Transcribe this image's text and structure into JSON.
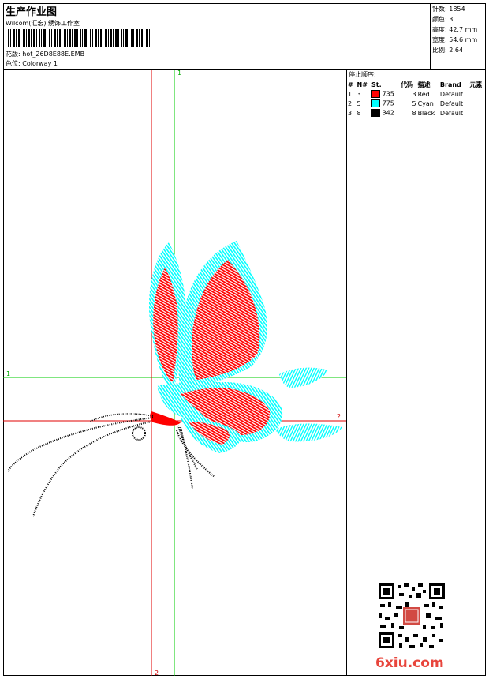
{
  "header": {
    "title": "生产作业图",
    "company": "Wilcom(汇宏) 绣饰工作室",
    "design_label": "花版:",
    "design_value": "hot_26D8E88E.EMB",
    "colorway_label": "色位:",
    "colorway_value": "Colorway 1"
  },
  "stats": [
    {
      "label": "针数:",
      "value": "1854"
    },
    {
      "label": "颜色:",
      "value": "3"
    },
    {
      "label": "高度:",
      "value": "42.7 mm"
    },
    {
      "label": "宽度:",
      "value": "54.6 mm"
    },
    {
      "label": "比例:",
      "value": "2.64"
    }
  ],
  "stop_sequence": {
    "heading": "停止顺序:",
    "columns": [
      "#",
      "N#",
      "St.",
      "代码",
      "描述",
      "Brand",
      "元素"
    ],
    "rows": [
      {
        "num": "1.",
        "n": "3",
        "color": "#ff0000",
        "st": "735",
        "code": "3",
        "desc": "Red",
        "brand": "Default",
        "elem": ""
      },
      {
        "num": "2.",
        "n": "5",
        "color": "#00ffff",
        "st": "775",
        "code": "5",
        "desc": "Cyan",
        "brand": "Default",
        "elem": ""
      },
      {
        "num": "3.",
        "n": "8",
        "color": "#000000",
        "st": "342",
        "code": "8",
        "desc": "Black",
        "brand": "Default",
        "elem": ""
      }
    ]
  },
  "axes": {
    "green_v": "1",
    "green_h": "1",
    "red_h": "2",
    "red_v": "2"
  },
  "colors": {
    "red": "#ff0000",
    "cyan": "#00ffff",
    "black": "#000000",
    "green": "#00cc00"
  },
  "watermark": "6xiu.com"
}
